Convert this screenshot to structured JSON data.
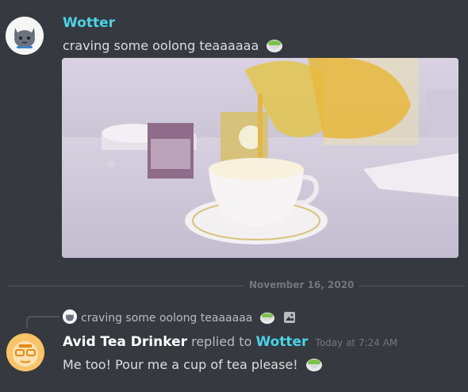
{
  "message1": {
    "author": "Wotter",
    "author_color": "#4bd3e6",
    "avatar_icon": "gray-cat-avatar",
    "text": "craving some oolong teaaaaaa",
    "emoji": "green-tea-emoji",
    "attachment": {
      "kind": "image",
      "description_icon": "anime-tea-pouring-image"
    }
  },
  "divider": {
    "date": "November 16, 2020"
  },
  "message2": {
    "reply_preview": {
      "avatar_icon": "gray-cat-avatar-small",
      "text": "craving some oolong teaaaaaa",
      "emoji": "green-tea-emoji",
      "attachment_icon": "image-icon"
    },
    "author": "Avid Tea Drinker",
    "author_color": "#ffffff",
    "avatar_icon": "orange-bear-avatar",
    "replied_to_text": "replied to",
    "replied_to_user": "Wotter",
    "replied_to_color": "#4bd3e6",
    "timestamp": "Today at 7:24 AM",
    "text": "Me too! Pour me a cup of tea please!",
    "emoji": "green-tea-emoji"
  }
}
